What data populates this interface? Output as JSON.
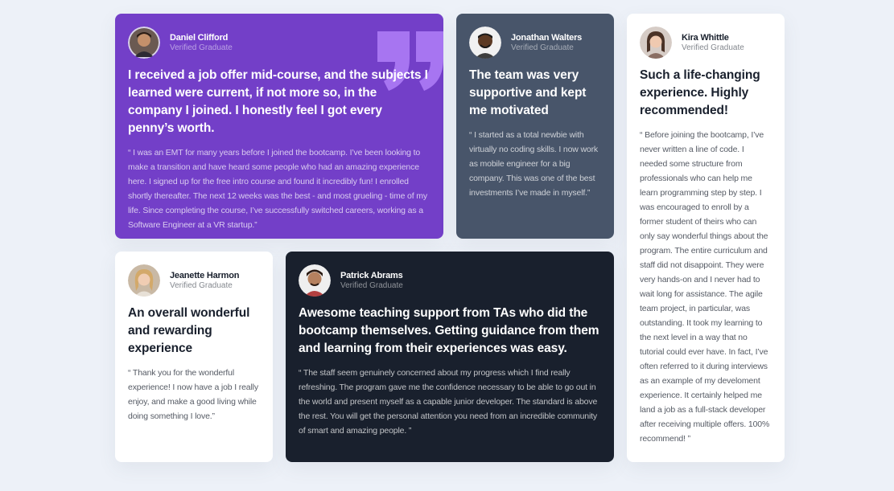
{
  "testimonials": {
    "daniel": {
      "avatar_icon": "person-avatar-icon",
      "name": "Daniel Clifford",
      "role": "Verified Graduate",
      "headline": "I received a job offer mid-course, and the subjects I learned were current, if not more so, in the company I joined. I honestly feel I got every penny’s worth.",
      "quote": "“ I was an EMT for many years before I joined the bootcamp. I’ve been looking to make a transition and have heard some people who had an amazing experience here. I signed up for the free intro course and found it incredibly fun! I enrolled shortly thereafter. The next 12 weeks was the best - and most grueling - time of my life. Since completing the course, I’ve successfully switched careers, working as a Software Engineer at a VR startup.”",
      "bg_color": "#733fc8"
    },
    "jonathan": {
      "avatar_icon": "person-avatar-icon",
      "name": "Jonathan Walters",
      "role": "Verified Graduate",
      "headline": "The team was very supportive and kept me motivated",
      "quote": "“ I started as a total newbie with virtually no coding skills. I now work as mobile engineer for a big company. This was one of the best investments I’ve made in myself.”",
      "bg_color": "#48556a"
    },
    "kira": {
      "avatar_icon": "person-avatar-icon",
      "name": "Kira Whittle",
      "role": "Verified Graduate",
      "headline": "Such a life-changing experience. Highly recommended!",
      "quote": "“ Before joining the bootcamp, I’ve never written a line of code. I needed some structure from professionals who can help me learn programming step by step. I was encouraged to enroll by a former student of theirs who can only say wonderful things about the program. The entire curriculum and staff did not disappoint. They were very hands-on and I never had to wait long for assistance. The agile team project, in particular, was outstanding. It took my learning to the next level in a way that no tutorial could ever have. In fact, I’ve often referred to it during interviews as an example of my develoment experience. It certainly helped me land a job as a full-stack developer after receiving multiple offers. 100% recommend! ”",
      "bg_color": "#ffffff"
    },
    "jeanette": {
      "avatar_icon": "person-avatar-icon",
      "name": "Jeanette Harmon",
      "role": "Verified Graduate",
      "headline": "An overall wonderful and rewarding experience",
      "quote": "“ Thank you for the wonderful experience! I now have a job I really enjoy, and make a good living while doing something I love.”",
      "bg_color": "#ffffff"
    },
    "patrick": {
      "avatar_icon": "person-avatar-icon",
      "name": "Patrick Abrams",
      "role": "Verified Graduate",
      "headline": "Awesome teaching support from TAs who did the bootcamp themselves. Getting guidance from them and learning from their experiences was easy.",
      "quote": "“ The staff seem genuinely concerned about my progress which I find really refreshing. The program gave me the confidence necessary to be able to go out in the world and present myself as a capable junior developer. The standard is above the rest. You will get the personal attention you need from an incredible community of smart and amazing people. ”",
      "bg_color": "#19202d"
    }
  },
  "colors": {
    "page_bg": "#edf1f8",
    "quote_mark": "#a775f1"
  },
  "icons": {
    "decorative_quote": "quotation-mark-icon"
  }
}
